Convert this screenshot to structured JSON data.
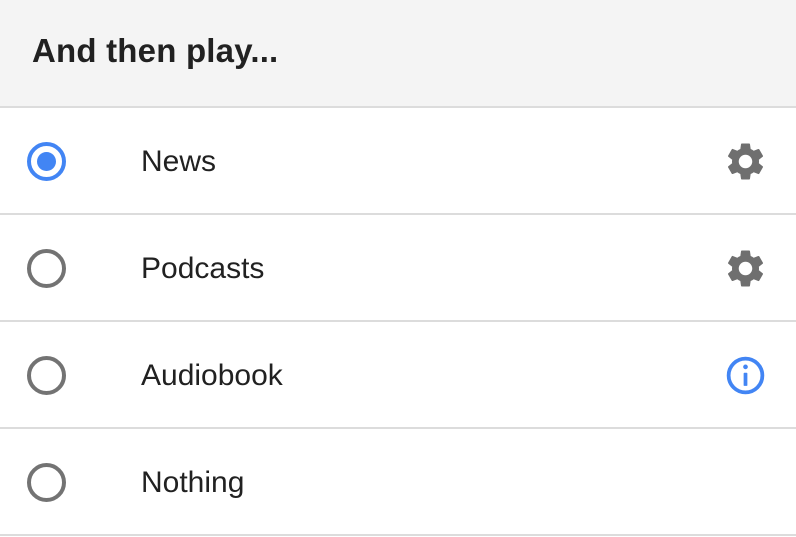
{
  "header": {
    "title": "And then play..."
  },
  "options": [
    {
      "label": "News",
      "selected": true,
      "action_icon": "gear-icon"
    },
    {
      "label": "Podcasts",
      "selected": false,
      "action_icon": "gear-icon"
    },
    {
      "label": "Audiobook",
      "selected": false,
      "action_icon": "info-icon"
    },
    {
      "label": "Nothing",
      "selected": false,
      "action_icon": null
    }
  ],
  "colors": {
    "accent": "#4285f4",
    "icon_gray": "#6f6f6f",
    "radio_unselected": "#737373",
    "header_bg": "#f4f4f4",
    "divider": "#dcdcdc",
    "text": "#212121"
  }
}
